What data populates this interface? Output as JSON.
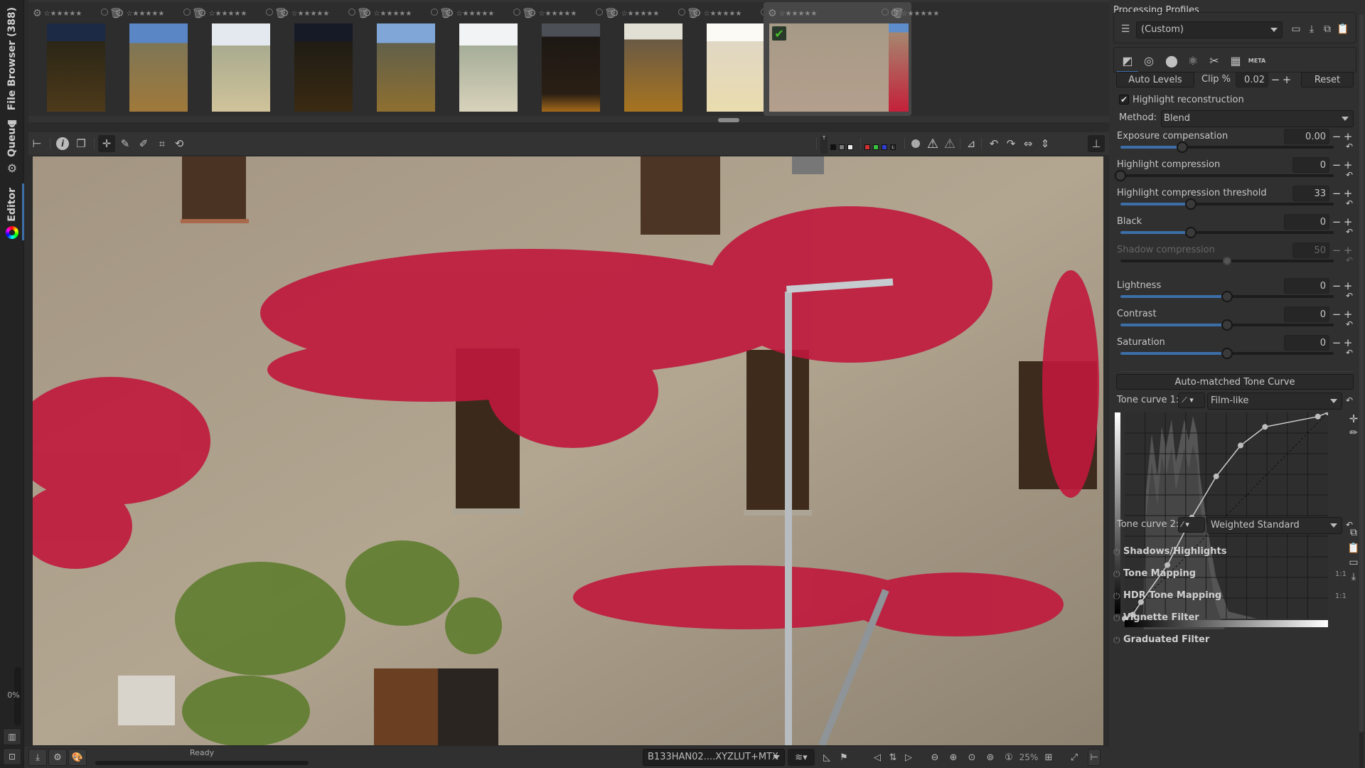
{
  "left_tabs": {
    "file_browser": "File Browser (388)",
    "queue": "Queue",
    "editor": "Editor",
    "progress": "0%"
  },
  "filmstrip": {
    "thumb_count": 11,
    "selected_index": 9,
    "stars": "☆★★★★★"
  },
  "toolbar": {
    "colors": {
      "red": "#d33030",
      "green": "#3ac040",
      "blue": "#2f3fd0"
    },
    "l_label": "L",
    "t_label": "T"
  },
  "statusbar": {
    "status": "Ready",
    "output_profile": "B133HAN02....XYZLUT+MTX",
    "zoom": "25%"
  },
  "right_panel": {
    "processing_profiles_title": "Processing Profiles",
    "profile_value": "(Custom)",
    "meta_tab": "META",
    "auto_levels": "Auto Levels",
    "clip_label": "Clip %",
    "clip_value": "0.02",
    "reset": "Reset",
    "highlight_reconstruction": "Highlight reconstruction",
    "highlight_reconstruction_checked": true,
    "method_label": "Method:",
    "method_value": "Blend",
    "sliders": [
      {
        "label": "Exposure compensation",
        "value": "0.00",
        "fraction": 0.29,
        "enabled": true
      },
      {
        "label": "Highlight compression",
        "value": "0",
        "fraction": 0.0,
        "enabled": true
      },
      {
        "label": "Highlight compression threshold",
        "value": "33",
        "fraction": 0.33,
        "enabled": true
      },
      {
        "label": "Black",
        "value": "0",
        "fraction": 0.33,
        "enabled": true
      },
      {
        "label": "Shadow compression",
        "value": "50",
        "fraction": 0.5,
        "enabled": false
      },
      {
        "label": "Lightness",
        "value": "0",
        "fraction": 0.5,
        "enabled": true
      },
      {
        "label": "Contrast",
        "value": "0",
        "fraction": 0.5,
        "enabled": true
      },
      {
        "label": "Saturation",
        "value": "0",
        "fraction": 0.5,
        "enabled": true
      }
    ],
    "auto_matched_tone_curve": "Auto-matched Tone Curve",
    "tone_curve_1_label": "Tone curve 1:",
    "tone_curve_1_value": "Film-like",
    "tone_curve_2_label": "Tone curve 2:",
    "tone_curve_2_value": "Weighted Standard",
    "curve_points": [
      [
        0,
        0
      ],
      [
        0.04,
        0.02
      ],
      [
        0.08,
        0.08
      ],
      [
        0.21,
        0.26
      ],
      [
        0.33,
        0.49
      ],
      [
        0.45,
        0.69
      ],
      [
        0.57,
        0.84
      ],
      [
        0.69,
        0.93
      ],
      [
        0.95,
        0.98
      ],
      [
        1,
        1
      ]
    ],
    "sections": [
      {
        "label": "Shadows/Highlights",
        "badge": ""
      },
      {
        "label": "Tone Mapping",
        "badge": "1:1"
      },
      {
        "label": "HDR Tone Mapping",
        "badge": "1:1"
      },
      {
        "label": "Vignette Filter",
        "badge": ""
      },
      {
        "label": "Graduated Filter",
        "badge": ""
      }
    ]
  }
}
